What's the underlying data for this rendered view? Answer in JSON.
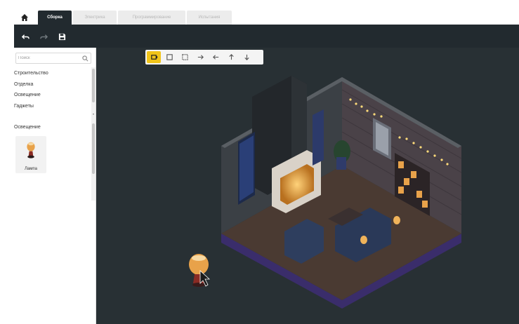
{
  "tabs": {
    "home_icon": "home-icon",
    "items": [
      {
        "label": "Сборка",
        "active": true
      },
      {
        "label": "Электрика",
        "active": false
      },
      {
        "label": "Программирование",
        "active": false
      },
      {
        "label": "Испытания",
        "active": false
      }
    ]
  },
  "toolbar": {
    "buttons": [
      "undo-icon",
      "redo-icon",
      "save-icon"
    ]
  },
  "sidebar": {
    "search_placeholder": "Поиск",
    "categories": [
      "Строительство",
      "Отделка",
      "Освещение",
      "Гаджеты"
    ],
    "section_label": "Освещение",
    "items": [
      {
        "label": "Лампа",
        "icon": "lamp-icon"
      }
    ]
  },
  "viewport": {
    "view_tools": [
      "view-front-icon",
      "view-square-icon",
      "view-outline-icon",
      "arrow-right-icon",
      "arrow-left-icon",
      "arrow-up-icon",
      "arrow-down-icon"
    ],
    "active_tool_index": 0
  },
  "colors": {
    "dark_bg": "#222a2f",
    "viewport_bg": "#283034",
    "accent": "#f0c419"
  }
}
